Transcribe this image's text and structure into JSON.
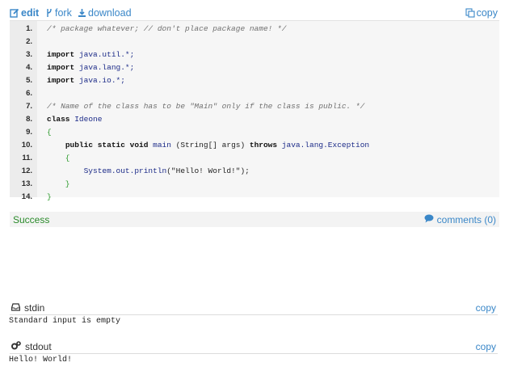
{
  "toolbar": {
    "edit": "edit",
    "fork": "fork",
    "download": "download",
    "copy": "copy"
  },
  "code": {
    "lines": [
      {
        "n": "1.",
        "tokens": [
          {
            "c": "cm",
            "t": "/* package whatever; // don't place package name! */"
          }
        ]
      },
      {
        "n": "2.",
        "tokens": []
      },
      {
        "n": "3.",
        "tokens": [
          {
            "c": "kw",
            "t": "import"
          },
          {
            "c": "",
            "t": " java.util.*;"
          }
        ]
      },
      {
        "n": "4.",
        "tokens": [
          {
            "c": "kw",
            "t": "import"
          },
          {
            "c": "",
            "t": " java.lang.*;"
          }
        ]
      },
      {
        "n": "5.",
        "tokens": [
          {
            "c": "kw",
            "t": "import"
          },
          {
            "c": "",
            "t": " java.io.*;"
          }
        ]
      },
      {
        "n": "6.",
        "tokens": []
      },
      {
        "n": "7.",
        "tokens": [
          {
            "c": "cm",
            "t": "/* Name of the class has to be \"Main\" only if the class is public. */"
          }
        ]
      },
      {
        "n": "8.",
        "tokens": [
          {
            "c": "kw",
            "t": "class"
          },
          {
            "c": "",
            "t": " Ideone"
          }
        ]
      },
      {
        "n": "9.",
        "tokens": [
          {
            "c": "br",
            "t": "{"
          }
        ]
      },
      {
        "n": "10.",
        "tokens": [
          {
            "c": "",
            "t": "    "
          },
          {
            "c": "kw",
            "t": "public static void"
          },
          {
            "c": "",
            "t": " main "
          },
          {
            "c": "pl",
            "t": "(String[] args)"
          },
          {
            "c": "",
            "t": " "
          },
          {
            "c": "kw",
            "t": "throws"
          },
          {
            "c": "",
            "t": " java.lang.Exception"
          }
        ]
      },
      {
        "n": "11.",
        "tokens": [
          {
            "c": "br",
            "t": "    {"
          }
        ]
      },
      {
        "n": "12.",
        "tokens": [
          {
            "c": "",
            "t": "        System.out.println"
          },
          {
            "c": "st",
            "t": "(\"Hello! World!\");"
          }
        ]
      },
      {
        "n": "13.",
        "tokens": [
          {
            "c": "br",
            "t": "    }"
          }
        ]
      },
      {
        "n": "14.",
        "tokens": [
          {
            "c": "br",
            "t": "}"
          }
        ]
      }
    ]
  },
  "result": {
    "status": "Success",
    "comments": "comments (0)"
  },
  "stdin": {
    "title": "stdin",
    "copy": "copy",
    "body": "Standard input is empty"
  },
  "stdout": {
    "title": "stdout",
    "copy": "copy",
    "body": "Hello! World!"
  },
  "colors": {
    "link": "#3a87c8",
    "success": "#2a8a2a",
    "code_background": "#f6f6f6"
  }
}
